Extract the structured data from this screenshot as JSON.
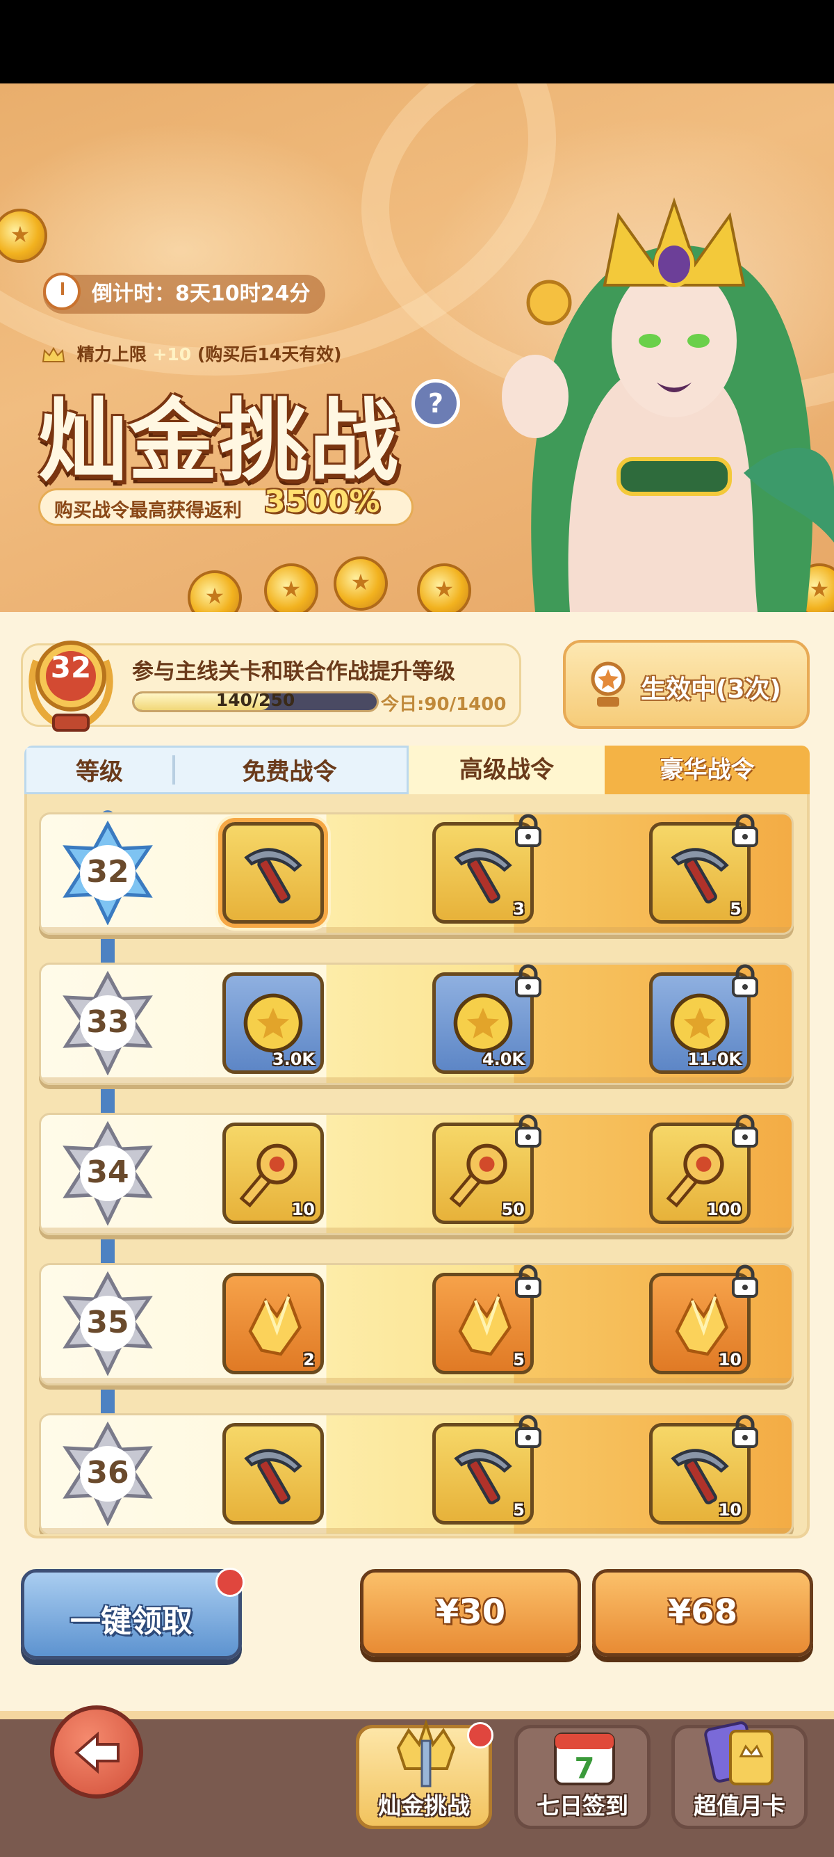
{
  "banner": {
    "timer": "倒计时：8天10时24分",
    "energy_label": "精力上限",
    "energy_value": "+10",
    "energy_note": "(购买后14天有效)",
    "title": "灿金挑战",
    "help": "?",
    "rebate_text": "购买战令最高获得返利",
    "rebate_pct": "3500%"
  },
  "level": {
    "current": "32",
    "description": "参与主线关卡和联合作战提升等级",
    "progress_text": "140/250",
    "progress_fraction": 0.56,
    "today": "今日:90/1400",
    "active_label": "生效中(3次)"
  },
  "tabs": {
    "level": "等级",
    "free": "免费战令",
    "premium": "高级战令",
    "deluxe": "豪华战令"
  },
  "rows": [
    {
      "level": "32",
      "free": {
        "icon": "pickaxe-icon",
        "qty": ""
      },
      "premium": {
        "icon": "pickaxe-icon",
        "qty": "3"
      },
      "deluxe": {
        "icon": "pickaxe-icon",
        "qty": "5"
      }
    },
    {
      "level": "33",
      "free": {
        "icon": "coin-icon",
        "qty": "3.0K"
      },
      "premium": {
        "icon": "coin-icon",
        "qty": "4.0K"
      },
      "deluxe": {
        "icon": "coin-icon",
        "qty": "11.0K"
      }
    },
    {
      "level": "34",
      "free": {
        "icon": "key-icon",
        "qty": "10"
      },
      "premium": {
        "icon": "key-icon",
        "qty": "50"
      },
      "deluxe": {
        "icon": "key-icon",
        "qty": "100"
      }
    },
    {
      "level": "35",
      "free": {
        "icon": "crystal-icon",
        "qty": "2"
      },
      "premium": {
        "icon": "crystal-icon",
        "qty": "5"
      },
      "deluxe": {
        "icon": "crystal-icon",
        "qty": "10"
      }
    },
    {
      "level": "36",
      "free": {
        "icon": "pickaxe-icon",
        "qty": ""
      },
      "premium": {
        "icon": "pickaxe-icon",
        "qty": "5"
      },
      "deluxe": {
        "icon": "pickaxe-icon",
        "qty": "10"
      }
    }
  ],
  "actions": {
    "claim_all": "一键领取",
    "price_premium": "¥30",
    "price_deluxe": "¥68"
  },
  "nav": {
    "active": "灿金挑战",
    "checkin": "七日签到",
    "checkin_day": "7",
    "monthly": "超值月卡"
  },
  "colors": {
    "accent": "#f4b345",
    "claim_blue": "#5d93d0",
    "badge_red": "#e0463e"
  }
}
